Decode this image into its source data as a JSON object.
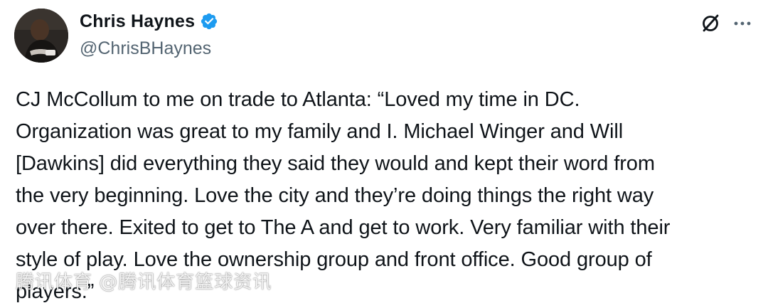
{
  "author": {
    "display_name": "Chris Haynes",
    "handle": "@ChrisBHaynes",
    "verified": true,
    "avatar_icon": "profile-photo"
  },
  "actions": {
    "grok_icon": "grok-icon",
    "more_icon": "more-horizontal-icon"
  },
  "tweet": {
    "lines": [
      "CJ McCollum to me on trade to Atlanta: “Loved my time in DC.",
      "Organization was great to my family and I. Michael Winger and Will",
      "[Dawkins] did everything they said they would and kept their word from",
      "the very beginning. Love the city and they’re doing things the right way",
      "over there. Exited to get to The A and get to work. Very familiar with their",
      "style of play. Love the ownership group and front office. Good group of",
      "players.”"
    ]
  },
  "watermark": {
    "text": "腾讯体育 @腾讯体育篮球资讯"
  },
  "colors": {
    "text_primary": "#0f1419",
    "text_secondary": "#536471",
    "verified_blue": "#1d9bf0"
  }
}
